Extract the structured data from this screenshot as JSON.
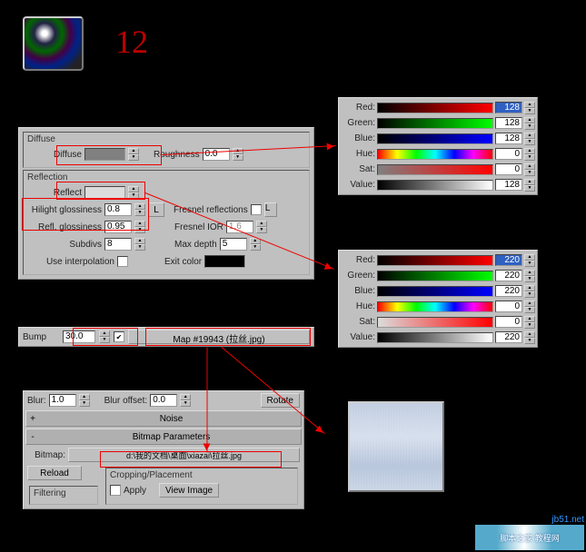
{
  "bigNumber": "12",
  "diffuse": {
    "groupLabel": "Diffuse",
    "diffuseLabel": "Diffuse",
    "roughnessLabel": "Roughness",
    "roughnessValue": "0.0"
  },
  "reflection": {
    "groupLabel": "Reflection",
    "reflectLabel": "Reflect",
    "hilightLabel": "Hilight glossiness",
    "hilightValue": "0.8",
    "reflGlossLabel": "Refl. glossiness",
    "reflGlossValue": "0.95",
    "subdivsLabel": "Subdivs",
    "subdivsValue": "8",
    "useInterpLabel": "Use interpolation",
    "lBtn": "L",
    "fresnelLabel": "Fresnel reflections",
    "fresnelIORLabel": "Fresnel IOR",
    "fresnelIORValue": "1.6",
    "maxDepthLabel": "Max depth",
    "maxDepthValue": "5",
    "exitColorLabel": "Exit color"
  },
  "colorLabels": {
    "red": "Red:",
    "green": "Green:",
    "blue": "Blue:",
    "hue": "Hue:",
    "sat": "Sat:",
    "value": "Value:"
  },
  "color1": {
    "r": "128",
    "g": "128",
    "b": "128",
    "h": "0",
    "s": "0",
    "v": "128"
  },
  "color2": {
    "r": "220",
    "g": "220",
    "b": "220",
    "h": "0",
    "s": "0",
    "v": "220"
  },
  "bump": {
    "label": "Bump",
    "value": "30.0",
    "mapLabel": "Map #19943 (拉丝.jpg)"
  },
  "bitmap": {
    "blurLabel": "Blur:",
    "blurValue": "1.0",
    "blurOffLabel": "Blur offset:",
    "blurOffValue": "0.0",
    "rotateLabel": "Rotate",
    "noiseLabel": "Noise",
    "bmpParamsLabel": "Bitmap Parameters",
    "bitmapLabel": "Bitmap:",
    "bitmapPath": "d:\\我的文档\\桌面\\xiazai\\拉丝.jpg",
    "reloadLabel": "Reload",
    "cropLabel": "Cropping/Placement",
    "applyLabel": "Apply",
    "viewLabel": "View Image",
    "filteringLabel": "Filtering",
    "plus": "+",
    "minus": "-"
  },
  "watermark": {
    "line1": "jb51.net",
    "line2": "脚本之家 教程网"
  }
}
